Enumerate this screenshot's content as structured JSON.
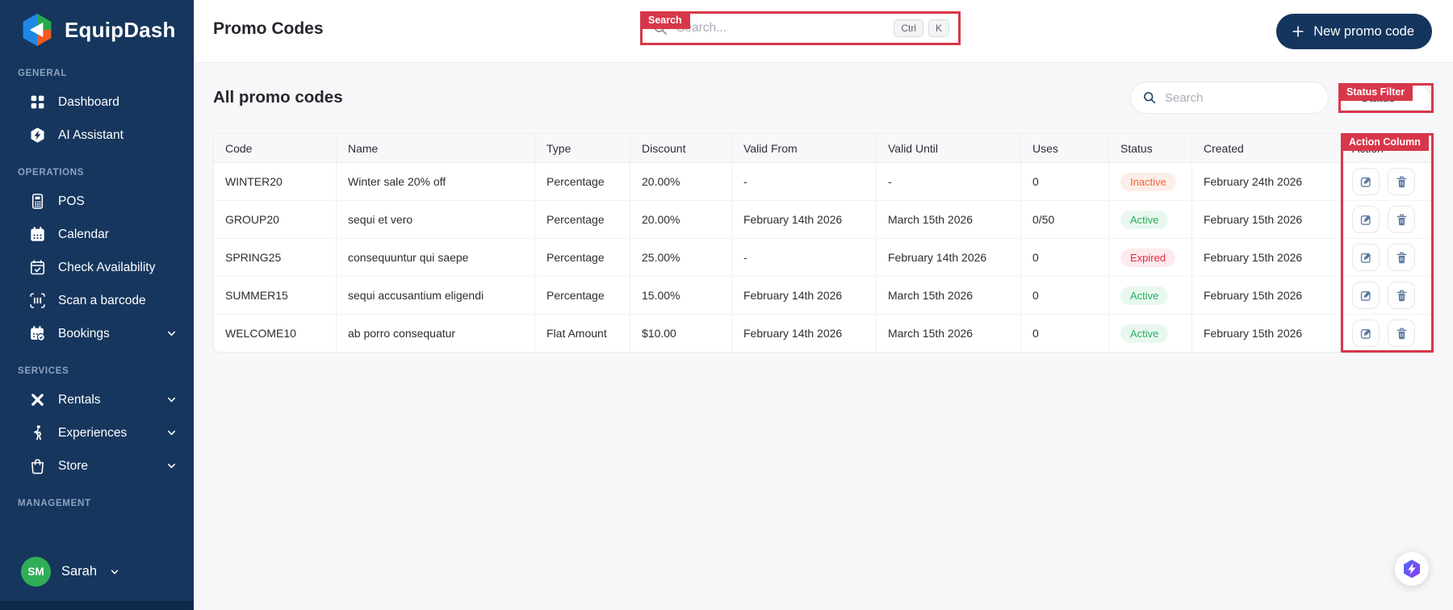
{
  "app": {
    "name": "EquipDash"
  },
  "header": {
    "title": "Promo Codes",
    "search": {
      "placeholder": "Search...",
      "keys": {
        "ctrl": "Ctrl",
        "k": "K"
      }
    },
    "new_button_label": "New promo code"
  },
  "annotations": {
    "search": "Search",
    "status_filter": "Status Filter",
    "action_column": "Action Column"
  },
  "sidebar": {
    "sections": {
      "general": {
        "label": "GENERAL",
        "items": [
          {
            "label": "Dashboard",
            "icon": "grid"
          },
          {
            "label": "AI Assistant",
            "icon": "shield-bolt"
          }
        ]
      },
      "operations": {
        "label": "OPERATIONS",
        "items": [
          {
            "label": "POS",
            "icon": "pos-terminal"
          },
          {
            "label": "Calendar",
            "icon": "calendar"
          },
          {
            "label": "Check Availability",
            "icon": "calendar-check"
          },
          {
            "label": "Scan a barcode",
            "icon": "barcode-scan"
          },
          {
            "label": "Bookings",
            "icon": "calendar-clock",
            "chevron": true
          }
        ]
      },
      "services": {
        "label": "SERVICES",
        "items": [
          {
            "label": "Rentals",
            "icon": "paddles",
            "chevron": true
          },
          {
            "label": "Experiences",
            "icon": "hiker",
            "chevron": true
          },
          {
            "label": "Store",
            "icon": "shopping-bag",
            "chevron": true
          }
        ]
      },
      "management": {
        "label": "MANAGEMENT",
        "items": []
      }
    },
    "user": {
      "initials": "SM",
      "name": "Sarah"
    }
  },
  "content": {
    "heading": "All promo codes",
    "search_placeholder": "Search",
    "status_filter_label": "Status"
  },
  "table": {
    "columns": [
      "Code",
      "Name",
      "Type",
      "Discount",
      "Valid From",
      "Valid Until",
      "Uses",
      "Status",
      "Created",
      "Action"
    ],
    "rows": [
      {
        "code": "WINTER20",
        "name": "Winter sale 20% off",
        "type": "Percentage",
        "discount": "20.00%",
        "valid_from": "-",
        "valid_until": "-",
        "uses": "0",
        "status": "Inactive",
        "created": "February 24th 2026"
      },
      {
        "code": "GROUP20",
        "name": "sequi et vero",
        "type": "Percentage",
        "discount": "20.00%",
        "valid_from": "February 14th 2026",
        "valid_until": "March 15th 2026",
        "uses": "0/50",
        "status": "Active",
        "created": "February 15th 2026"
      },
      {
        "code": "SPRING25",
        "name": "consequuntur qui saepe",
        "type": "Percentage",
        "discount": "25.00%",
        "valid_from": "-",
        "valid_until": "February 14th 2026",
        "uses": "0",
        "status": "Expired",
        "created": "February 15th 2026"
      },
      {
        "code": "SUMMER15",
        "name": "sequi accusantium eligendi",
        "type": "Percentage",
        "discount": "15.00%",
        "valid_from": "February 14th 2026",
        "valid_until": "March 15th 2026",
        "uses": "0",
        "status": "Active",
        "created": "February 15th 2026"
      },
      {
        "code": "WELCOME10",
        "name": "ab porro consequatur",
        "type": "Flat Amount",
        "discount": "$10.00",
        "valid_from": "February 14th 2026",
        "valid_until": "March 15th 2026",
        "uses": "0",
        "status": "Active",
        "created": "February 15th 2026"
      }
    ]
  },
  "fab": {
    "icon": "assistant-bolt"
  },
  "colors": {
    "sidebar_navy": "#16365e",
    "sidebar_footer_navy": "#0e2a4b",
    "primary_button_navy": "#14355d",
    "annotation_red": "#d8374a",
    "avatar_green": "#2fae57",
    "status_active_text": "#27ae60",
    "status_active_bg": "#e9f8ef",
    "status_inactive_text": "#f4633a",
    "status_inactive_bg": "#fdeee7",
    "status_expired_text": "#e8273e",
    "status_expired_bg": "#fdeaec",
    "assistant_gradient": [
      "#4e6bf5",
      "#8a3bf0"
    ],
    "logo_blue": "#1e88e5",
    "logo_green": "#27a84a",
    "logo_orange": "#f4591f"
  }
}
